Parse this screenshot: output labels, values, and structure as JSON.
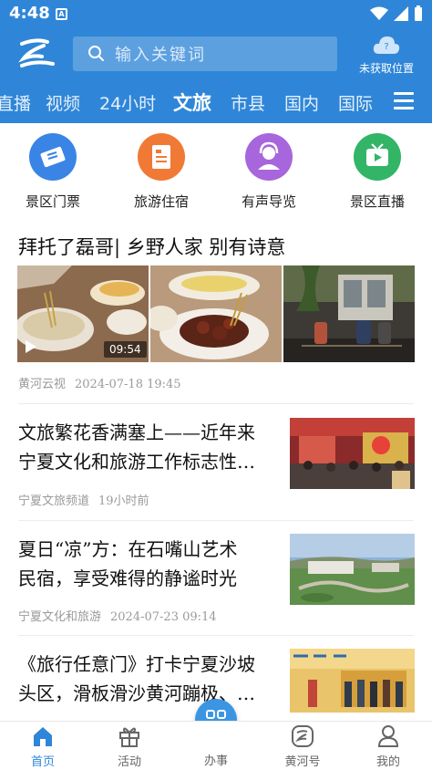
{
  "status_bar": {
    "time": "4:48",
    "sim_label": "A"
  },
  "header": {
    "search_placeholder": "输入关键词",
    "location_text": "未获取位置",
    "location_badge": "?"
  },
  "nav": {
    "items": [
      "直播",
      "视频",
      "24小时",
      "文旅",
      "市县",
      "国内",
      "国际"
    ],
    "active": "文旅"
  },
  "quick": [
    {
      "label": "景区门票",
      "icon": "ticket-icon",
      "color": "#3a84e6"
    },
    {
      "label": "旅游住宿",
      "icon": "document-icon",
      "color": "#f07a35"
    },
    {
      "label": "有声导览",
      "icon": "headset-guide-icon",
      "color": "#a766dc"
    },
    {
      "label": "景区直播",
      "icon": "tv-play-icon",
      "color": "#32b566"
    }
  ],
  "articles": [
    {
      "title": "拜托了磊哥| 乡野人家 别有诗意",
      "source": "黄河云视",
      "time": "2024-07-18 19:45",
      "duration": "09:54"
    },
    {
      "title_lines": [
        "文旅繁花香满塞上——近年来",
        "宁夏文化和旅游工作标志性…"
      ],
      "source": "宁夏文旅频道",
      "time": "19小时前"
    },
    {
      "title_lines": [
        "夏日“凉”方：在石嘴山艺术",
        "民宿，享受难得的静谧时光"
      ],
      "source": "宁夏文化和旅游",
      "time": "2024-07-23 09:14"
    },
    {
      "title_lines": [
        "《旅行任意门》打卡宁夏沙坡",
        "头区，滑板滑沙黄河蹦极、…"
      ]
    }
  ],
  "tabbar": {
    "items": [
      {
        "label": "首页",
        "icon": "home-icon",
        "active": true
      },
      {
        "label": "活动",
        "icon": "gift-icon",
        "active": false
      },
      {
        "label": "办事",
        "icon": "grid-icon",
        "active": false
      },
      {
        "label": "黄河号",
        "icon": "huanghe-logo-icon",
        "active": false
      },
      {
        "label": "我的",
        "icon": "user-icon",
        "active": false
      }
    ]
  },
  "colors": {
    "brand": "#2f86d8",
    "active_tab": "#2f86d8"
  }
}
